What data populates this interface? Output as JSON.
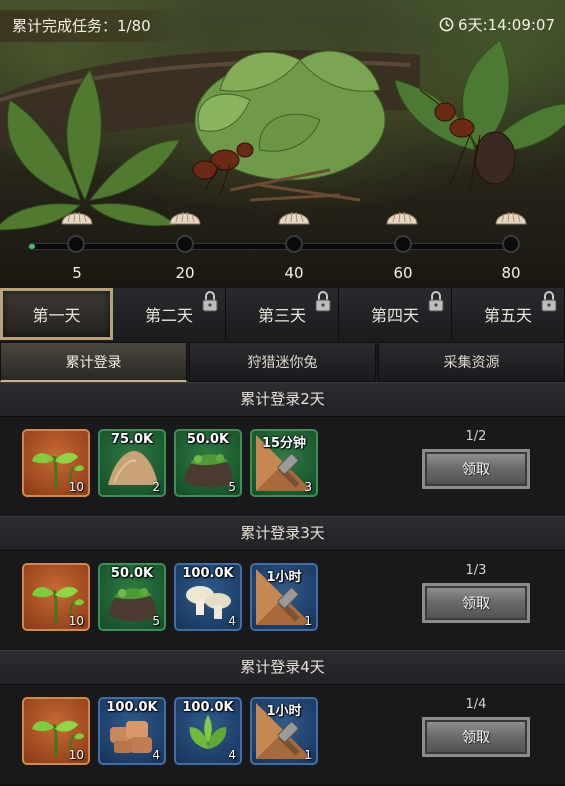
{
  "header": {
    "task_counter": "累计完成任务：1/80",
    "timer": "6天:14:09:07",
    "timer_icon": "clock-icon"
  },
  "progress": {
    "current": 1,
    "max": 80,
    "milestones": [
      "5",
      "20",
      "40",
      "60",
      "80"
    ]
  },
  "day_tabs": [
    {
      "label": "第一天",
      "locked": false,
      "active": true
    },
    {
      "label": "第二天",
      "locked": true,
      "active": false
    },
    {
      "label": "第三天",
      "locked": true,
      "active": false
    },
    {
      "label": "第四天",
      "locked": true,
      "active": false
    },
    {
      "label": "第五天",
      "locked": true,
      "active": false
    }
  ],
  "sub_tabs": [
    {
      "label": "累计登录",
      "active": true
    },
    {
      "label": "狩猎迷你兔",
      "active": false
    },
    {
      "label": "采集资源",
      "active": false
    }
  ],
  "sections": [
    {
      "title": "累计登录2天",
      "progress": "1/2",
      "button": "领取",
      "items": [
        {
          "icon": "sprout-icon",
          "frame": "orange",
          "amount": "",
          "count": "10"
        },
        {
          "icon": "sand-pile-icon",
          "frame": "green",
          "amount": "75.0K",
          "count": "2"
        },
        {
          "icon": "moss-rock-icon",
          "frame": "green",
          "amount": "50.0K",
          "count": "5"
        },
        {
          "icon": "speedup-hammer-icon",
          "frame": "green",
          "amount": "15分钟",
          "count": "3"
        }
      ]
    },
    {
      "title": "累计登录3天",
      "progress": "1/3",
      "button": "领取",
      "items": [
        {
          "icon": "sprout-icon",
          "frame": "orange",
          "amount": "",
          "count": "10"
        },
        {
          "icon": "moss-rock-icon",
          "frame": "green",
          "amount": "50.0K",
          "count": "5"
        },
        {
          "icon": "mushroom-icon",
          "frame": "blue",
          "amount": "100.0K",
          "count": "4"
        },
        {
          "icon": "speedup-hammer-icon",
          "frame": "blue",
          "amount": "1小时",
          "count": "1"
        }
      ]
    },
    {
      "title": "累计登录4天",
      "progress": "1/4",
      "button": "领取",
      "items": [
        {
          "icon": "sprout-icon",
          "frame": "orange",
          "amount": "",
          "count": "10"
        },
        {
          "icon": "meat-chunks-icon",
          "frame": "blue",
          "amount": "100.0K",
          "count": "4"
        },
        {
          "icon": "leaves-icon",
          "frame": "blue",
          "amount": "100.0K",
          "count": "4"
        },
        {
          "icon": "speedup-hammer-icon",
          "frame": "blue",
          "amount": "1小时",
          "count": "1"
        }
      ]
    }
  ]
}
